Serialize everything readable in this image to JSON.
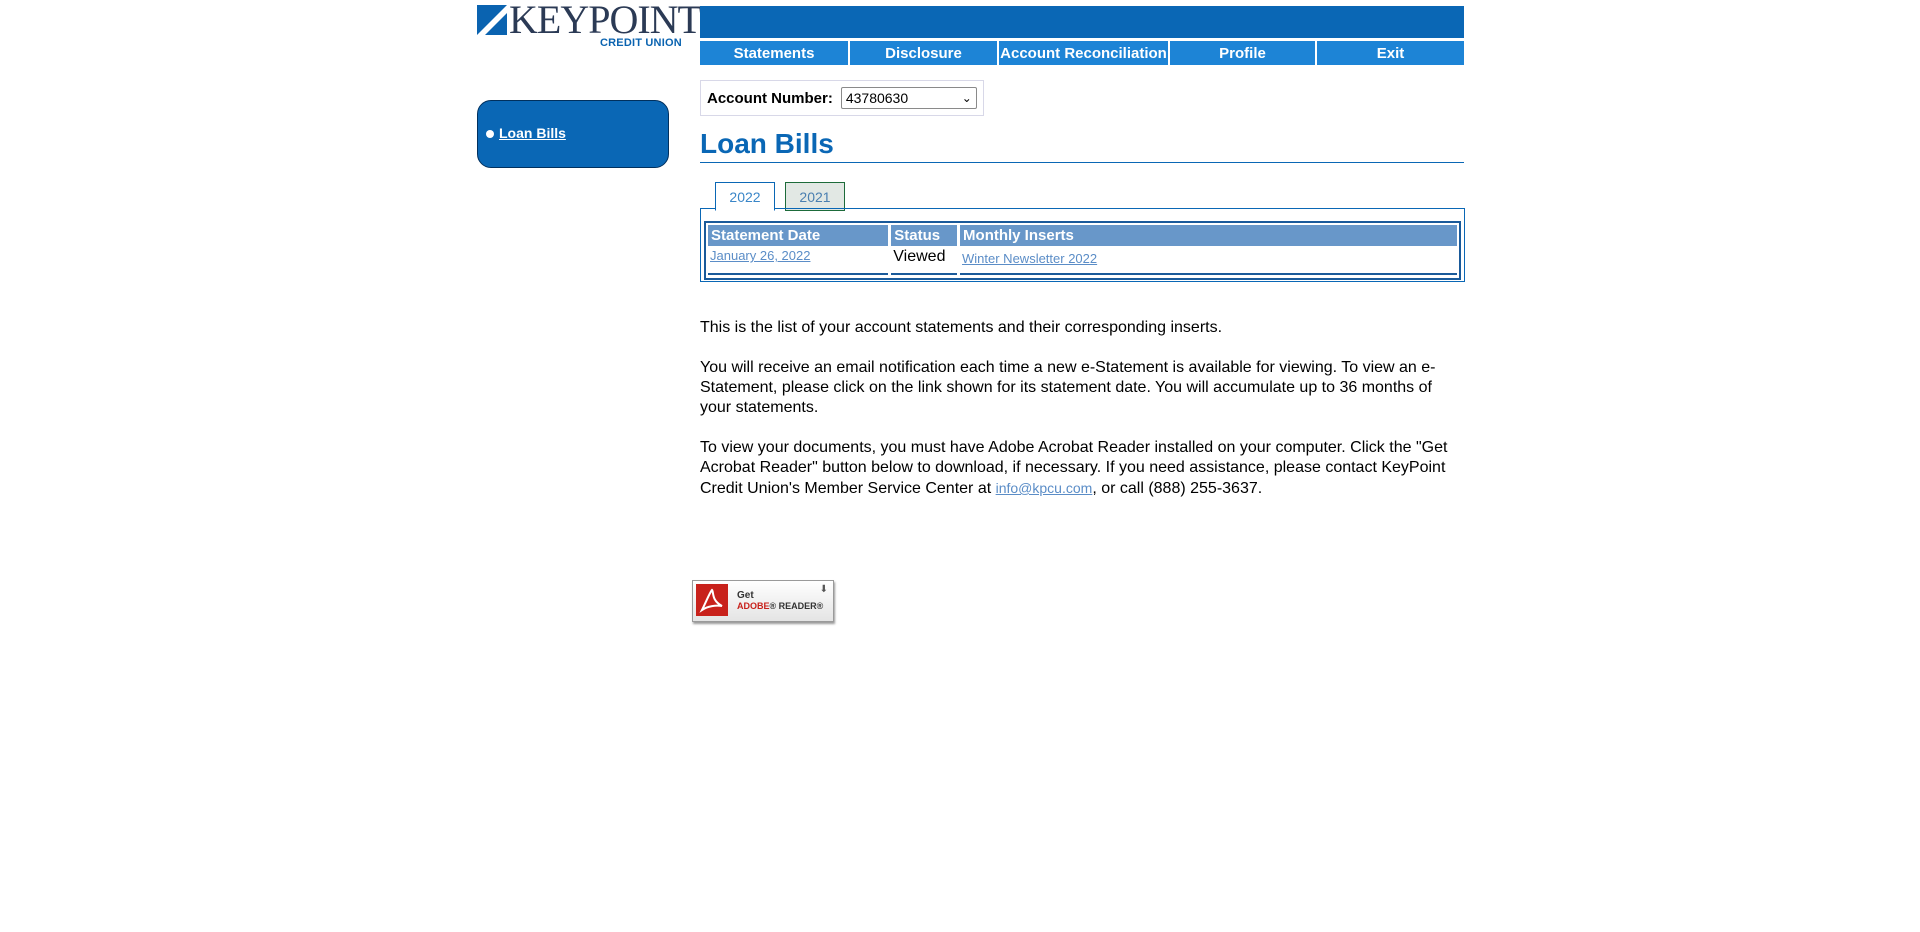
{
  "logo": {
    "brand": "KEYPOINT",
    "subtitle": "CREDIT UNION"
  },
  "nav": {
    "items": [
      {
        "label": "Statements",
        "name": "nav-statements"
      },
      {
        "label": "Disclosure",
        "name": "nav-disclosure"
      },
      {
        "label": "Account Reconciliation",
        "name": "nav-account-reconciliation"
      },
      {
        "label": "Profile",
        "name": "nav-profile"
      },
      {
        "label": "Exit",
        "name": "nav-exit"
      }
    ]
  },
  "sidebar": {
    "items": [
      {
        "label": "Loan Bills"
      }
    ]
  },
  "account": {
    "label": "Account Number:",
    "selected": "43780630"
  },
  "page": {
    "title": "Loan Bills"
  },
  "tabs": [
    {
      "label": "2022",
      "active": true
    },
    {
      "label": "2021",
      "active": false
    }
  ],
  "table": {
    "headers": [
      "Statement Date",
      "Status",
      "Monthly Inserts"
    ],
    "rows": [
      {
        "date": "January 26, 2022",
        "status": "Viewed",
        "insert": "Winter Newsletter 2022"
      }
    ]
  },
  "info": {
    "p1": "This is the list of your account statements and their corresponding inserts.",
    "p2": "You will receive an email notification each time a new e-Statement is available for viewing. To view an e-Statement, please click on the link shown for its statement date. You will accumulate up to 36 months of your statements.",
    "p3_before": "To view your documents, you must have Adobe Acrobat Reader installed on your computer. Click the \"Get Acrobat Reader\" button below to download, if necessary. If you need assistance, please contact KeyPoint Credit Union's Member Service Center at ",
    "email": "info@kpcu.com",
    "p3_after": ", or call (888) 255-3637."
  },
  "adobe": {
    "line1": "Get",
    "brand": "ADOBE",
    "reader": "READER"
  },
  "colors": {
    "primary": "#0a67b5",
    "nav": "#1d84d6",
    "table_header": "#6897c9",
    "link": "#5b8dc7"
  }
}
